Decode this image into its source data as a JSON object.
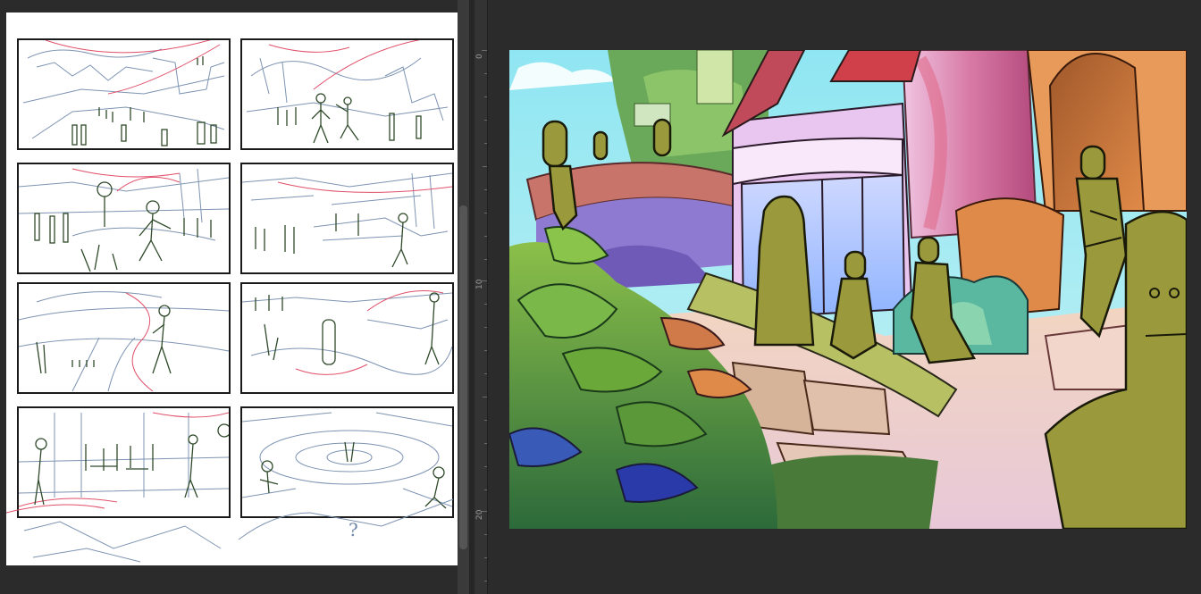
{
  "sketch_sheet": {
    "panels": [
      {
        "id": "panel-1"
      },
      {
        "id": "panel-2"
      },
      {
        "id": "panel-3"
      },
      {
        "id": "panel-4"
      },
      {
        "id": "panel-5"
      },
      {
        "id": "panel-6"
      },
      {
        "id": "panel-7"
      },
      {
        "id": "panel-8"
      }
    ],
    "note_mark": "?"
  },
  "ruler": {
    "labels": [
      "0",
      "10",
      "20"
    ]
  },
  "colors": {
    "sketch_blue": "#6f86a8",
    "sketch_green": "#2f4a2a",
    "sketch_red": "#e0506a",
    "figure_fill": "#9a9a3c",
    "sky": "#8fe0f0",
    "building_pink": "#d87aa6",
    "foliage_green": "#5a8a3a"
  },
  "icons": [
    "ruler-icon",
    "scrollbar-icon"
  ]
}
